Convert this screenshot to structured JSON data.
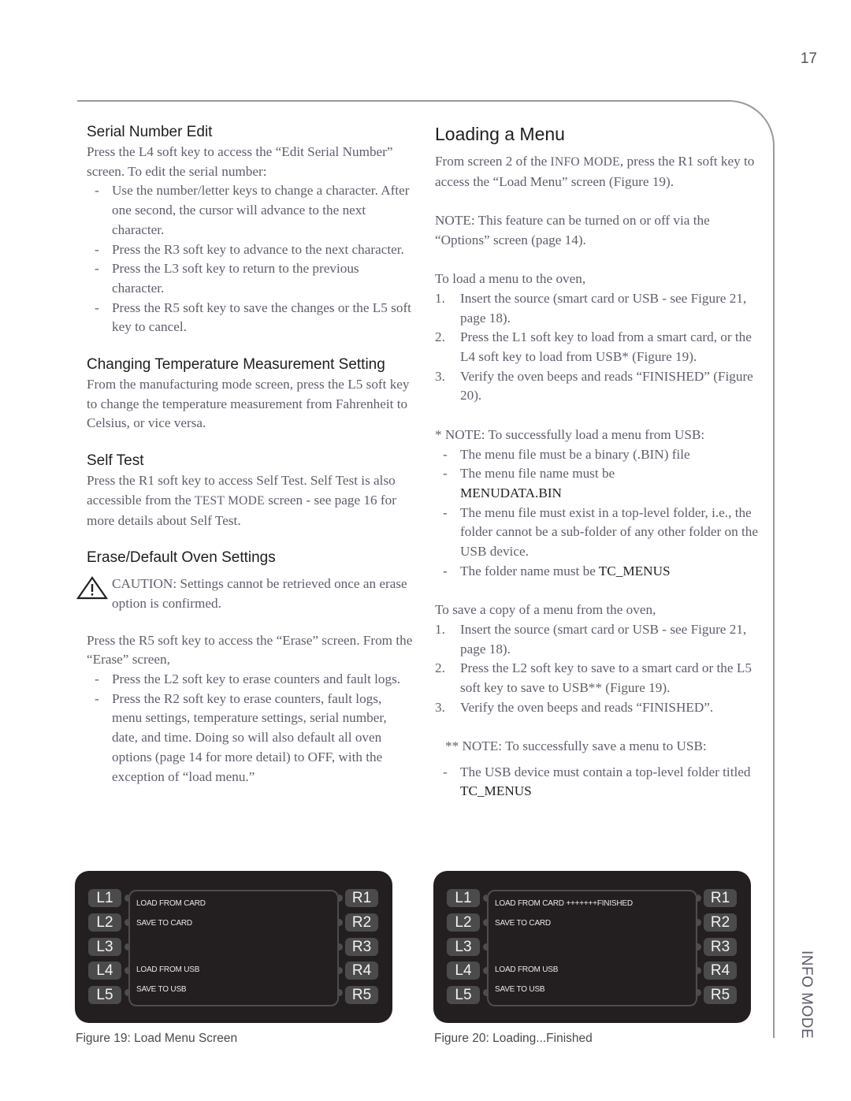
{
  "page_number": "17",
  "side_tab": "INFO MODE",
  "left": {
    "serial": {
      "heading": "Serial Number Edit",
      "intro": "Press the L4 soft key to access the “Edit Serial Number” screen. To edit the serial number:",
      "bullets": [
        "Use the number/letter keys to change a character. After one second, the cursor will advance to the next character.",
        "Press the R3 soft key to advance to the next character.",
        "Press the L3 soft key to return to the previous character.",
        "Press the R5 soft key to save the changes or the L5 soft key to cancel."
      ]
    },
    "temp": {
      "heading": "Changing Temperature Measurement Setting",
      "body": "From the manufacturing mode screen, press the L5 soft key to change the temperature measurement from Fahrenheit to Celsius, or vice versa."
    },
    "selftest": {
      "heading": "Self Test",
      "body_pre": "Press the R1 soft key to access Self Test. Self Test is also accessible from the ",
      "body_sc": "TEST MODE",
      "body_post": " screen - see page 16 for more details about Self Test."
    },
    "erase": {
      "heading": "Erase/Default Oven Settings",
      "caution": "CAUTION: Settings cannot be retrieved once an erase option is confirmed.",
      "intro": "Press the R5 soft key to access the “Erase” screen. From the “Erase” screen,",
      "bullets": [
        "Press the L2 soft key to erase counters and fault logs.",
        "Press the R2 soft key to erase counters, fault logs, menu settings, temperature settings, serial number, date, and time. Doing so will also default all oven options (page 14 for more detail) to OFF, with the exception of “load menu.”"
      ]
    }
  },
  "right": {
    "title": "Loading a Menu",
    "intro_pre": "From screen 2 of the ",
    "intro_sc": "INFO MODE",
    "intro_post": ", press the R1 soft key to access the “Load Menu” screen (Figure 19).",
    "note": "NOTE: This feature can be turned on or off via the “Options” screen (page 14).",
    "load_intro": "To load a menu to the oven,",
    "load_steps": [
      "Insert the source (smart card or USB - see Figure 21, page 18).",
      "Press the L1 soft key to load from a smart card, or the L4 soft key to load from USB* (Figure 19).",
      "Verify the oven beeps and reads “FINISHED” (Figure 20)."
    ],
    "usb_note": "* NOTE: To successfully load a menu from USB:",
    "usb_bullets": {
      "b1": "The menu file must be a binary (.BIN) file",
      "b2_pre": "The menu file name must be ",
      "b2_dark": "MENUDATA.BIN",
      "b3": "The menu file must exist in a top-level folder, i.e., the folder cannot be a sub-folder of any other folder on the USB device.",
      "b4_pre": "The folder name must be ",
      "b4_dark": "TC_MENUS"
    },
    "save_intro": "To save a copy of a menu from the oven,",
    "save_steps": [
      "Insert the source (smart card or USB - see Figure 21, page 18).",
      "Press the L2 soft key to save to a smart card or the L5 soft key to save to USB** (Figure 19).",
      "Verify the oven beeps and reads “FINISHED”."
    ],
    "save_note": "** NOTE: To successfully save a menu to USB:",
    "save_bullet_pre": "The USB device must contain a top-level folder titled ",
    "save_bullet_dark": "TC_MENUS"
  },
  "figures": [
    {
      "caption": "Figure 19: Load Menu Screen",
      "left_keys": [
        "L1",
        "L2",
        "L3",
        "L4",
        "L5"
      ],
      "right_keys": [
        "R1",
        "R2",
        "R3",
        "R4",
        "R5"
      ],
      "lines": [
        "LOAD FROM CARD",
        "SAVE TO CARD",
        "",
        "LOAD FROM USB",
        "SAVE TO USB"
      ]
    },
    {
      "caption": "Figure 20: Loading...Finished",
      "left_keys": [
        "L1",
        "L2",
        "L3",
        "L4",
        "L5"
      ],
      "right_keys": [
        "R1",
        "R2",
        "R3",
        "R4",
        "R5"
      ],
      "lines": [
        "LOAD FROM CARD +++++++FINISHED",
        "SAVE TO CARD",
        "",
        "LOAD FROM USB",
        "SAVE TO USB"
      ]
    }
  ]
}
